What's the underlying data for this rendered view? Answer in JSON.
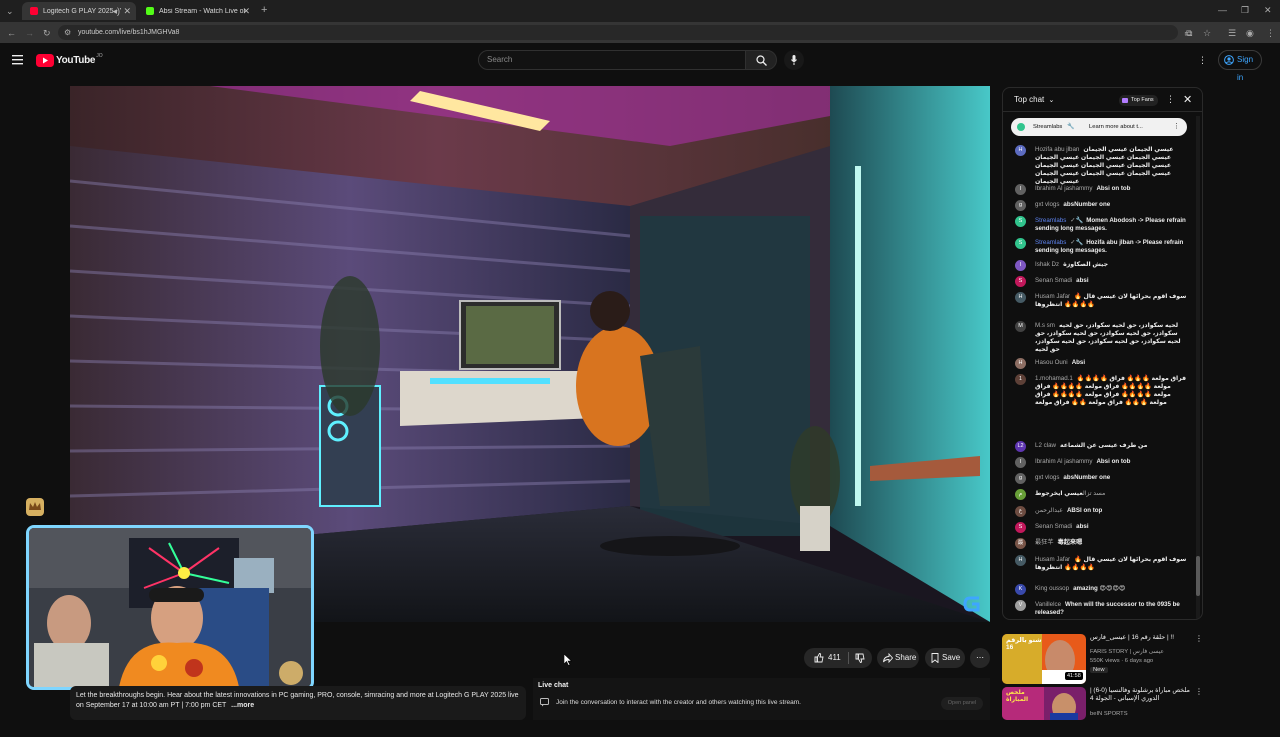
{
  "browser": {
    "tabs": [
      {
        "title": "Logitech G PLAY 2025 - You",
        "active": true,
        "favicon_color": "#ff0033"
      },
      {
        "title": "Absi Stream - Watch Live on K",
        "active": false,
        "favicon_color": "#53fc18"
      }
    ],
    "url": "youtube.com/live/bs1hJMGHVa8"
  },
  "header": {
    "logo": "YouTube",
    "logo_sup": "JO",
    "search_placeholder": "Search",
    "sign_in": "Sign in"
  },
  "actions": {
    "likes": "411",
    "share": "Share",
    "save": "Save"
  },
  "description": {
    "text": "Let the breakthroughs begin. Hear about the latest innovations in PC gaming, PRO, console, simracing and more at Logitech G PLAY 2025 live on September 17 at 10:00 am PT | 7:00 pm CET",
    "more": "...more"
  },
  "livechat_bar": {
    "title": "Live chat",
    "prompt": "Join the conversation to interact with the creator and others watching this live stream.",
    "open_panel": "Open panel"
  },
  "chat": {
    "mode": "Top chat",
    "top_fans": "Top Fans",
    "pinned": {
      "name": "Streamlabs",
      "text": "Learn more about t..."
    },
    "messages": [
      {
        "name": "Hozifa abu jlban",
        "text": "عيسي الجيمان عيسي الجيمان عيسي الجيمان عيسي الجيمان عيسي الجيمان عيسي الجيمان عيسي الجيمان عيسي الجيمان عيسي الجيمان عيسي الجيمان عيسي الجيمان عيسي الجيمان",
        "color": "#5c6bc0",
        "initial": "H",
        "mod": false
      },
      {
        "name": "Ibrahim Al jashammy",
        "text": "Absi on tob",
        "color": "#616161",
        "initial": "I",
        "mod": false
      },
      {
        "name": "gxt vlogs",
        "text": "absNumber one",
        "color": "#616161",
        "initial": "g",
        "mod": false
      },
      {
        "name": "Streamlabs",
        "text": "Momen Abodosh -> Please refrain sending long messages.",
        "color": "#31c48d",
        "initial": "S",
        "mod": true
      },
      {
        "name": "Streamlabs",
        "text": "Hozifa abu jlban -> Please refrain sending long messages.",
        "color": "#31c48d",
        "initial": "S",
        "mod": true
      },
      {
        "name": "Ishak Dz",
        "text": "جيش الصكاوزة",
        "color": "#7e57c2",
        "initial": "I",
        "mod": false
      },
      {
        "name": "Senan Smadi",
        "text": "absi",
        "color": "#c2185b",
        "initial": "S",
        "mod": false
      },
      {
        "name": "Husam Jafar",
        "text": "🔥 سوف اقوم بحرائها لان عيسي قال انتظروها 🔥🔥🔥🔥",
        "color": "#455a64",
        "initial": "H",
        "mod": false
      },
      {
        "name": "M.s sm",
        "text": "لحيه سكوادز، حق لحيه سكوادز، حق لحيه سكوادز، حق لحيه سكوادز، حق لحيه سكوادز، حق لحيه سكوادز، حق لحيه سكوادز، حق لحيه سكوادز، حق لحيه",
        "color": "#424242",
        "initial": "M",
        "mod": false
      },
      {
        "name": "Hasou Ouni",
        "text": "Absi",
        "color": "#8d6e63",
        "initial": "H",
        "mod": false
      },
      {
        "name": "1.mohamad.1",
        "text": "🔥🔥🔥🔥 فراق مولعة 🔥🔥🔥 فراق مولعة 🔥🔥🔥🔥 فراق مولعة 🔥🔥🔥🔥 فراق مولعة 🔥🔥🔥🔥 فراق مولعة 🔥🔥🔥🔥 فراق مولعة 🔥🔥🔥 فراق مولعة 🔥🔥 فراق مولعة",
        "color": "#5d4037",
        "initial": "1",
        "mod": false
      },
      {
        "name": "L2 claw",
        "text": "من طرف عيسى عن الشماعة",
        "color": "#5e35b1",
        "initial": "L2",
        "mod": false
      },
      {
        "name": "Ibrahim Al jashammy",
        "text": "Absi on tob",
        "color": "#616161",
        "initial": "I",
        "mod": false
      },
      {
        "name": "gxt vlogs",
        "text": "absNumber one",
        "color": "#616161",
        "initial": "g",
        "mod": false
      },
      {
        "name": "مسد تزال",
        "text": "عيسي ايخرجوط",
        "color": "#689f38",
        "initial": "م",
        "mod": false
      },
      {
        "name": "عبدالرحمن",
        "text": "ABSI on top",
        "color": "#6d4c41",
        "initial": "ع",
        "mod": false
      },
      {
        "name": "Senan Smadi",
        "text": "absi",
        "color": "#c2185b",
        "initial": "S",
        "mod": false
      },
      {
        "name": "最狂芊",
        "text": "毒起来嗯",
        "color": "#795548",
        "initial": "最",
        "mod": false
      },
      {
        "name": "Husam Jafar",
        "text": "🔥 سوف اقوم بحرائها لان عيسي قال انتظروها 🔥🔥🔥🔥",
        "color": "#455a64",
        "initial": "H",
        "mod": false
      },
      {
        "name": "King oussop",
        "text": "amazing 😍😍😍😍",
        "color": "#3949ab",
        "initial": "K",
        "mod": false
      },
      {
        "name": "Vanillelce",
        "text": "When will the successor to the 0935 be released?",
        "color": "#9e9e9e",
        "initial": "V",
        "mod": false
      }
    ]
  },
  "recommendations": [
    {
      "title": "حلقة رقم 16 | عيسى_فارس | !!",
      "channel": "FARIS STORY | عيسى فارس",
      "meta": "550K views · 6 days ago",
      "badge": "New",
      "duration": "41:58",
      "thumb_text": "شنو بالرقم 16"
    },
    {
      "title": "ملخص مباراة برشلونة وفالنسيا (0-6) | الدوري الإسباني - الجولة 4",
      "channel": "beIN SPORTS",
      "meta": "",
      "badge": "",
      "duration": "",
      "thumb_text": "ملخص المباراة"
    }
  ],
  "colors": {
    "accent": "#3ea6ff",
    "youtube_red": "#ff0033",
    "cam_border": "#7fd6ff"
  }
}
